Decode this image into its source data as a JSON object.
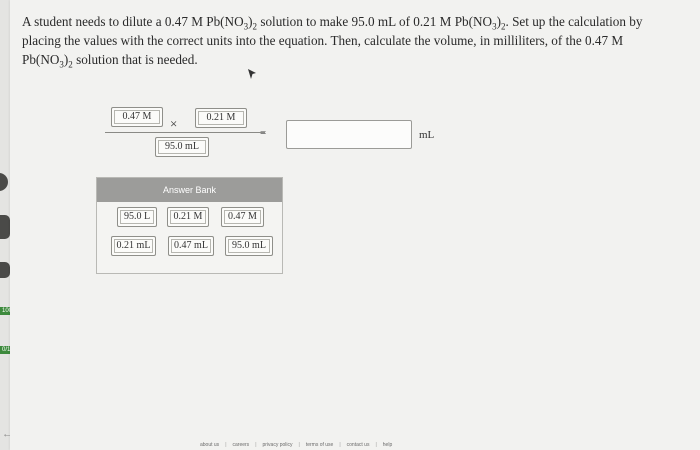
{
  "question": {
    "part1": "A student needs to dilute a 0.47 M Pb(NO",
    "sub1": "3",
    "part2": ")",
    "sub2": "2",
    "part3": " solution to make 95.0 mL of 0.21 M Pb(NO",
    "sub3": "3",
    "part4": ")",
    "sub4": "2",
    "part5": ". Set up the calculation by placing the values with the correct units into the equation. Then, calculate the volume, in milliliters, of the 0.47 M Pb(NO",
    "sub5": "3",
    "part6": ")",
    "sub6": "2",
    "part7": " solution that is needed."
  },
  "equation": {
    "numerator_left": "0.47 M",
    "times_symbol": "×",
    "numerator_right": "0.21 M",
    "denominator": "95.0 mL",
    "equals_symbol": "=",
    "answer_value": "",
    "answer_unit": "mL"
  },
  "answer_bank": {
    "title": "Answer Bank",
    "row1": [
      "95.0 L",
      "0.21 M",
      "0.47 M"
    ],
    "row2": [
      "0.21 mL",
      "0.47 mL",
      "95.0 mL"
    ]
  },
  "side": {
    "score1": "100",
    "score2": "0/100"
  },
  "footer": {
    "links": [
      "about us",
      "careers",
      "privacy policy",
      "terms of use",
      "contact us",
      "help"
    ]
  },
  "colors": {
    "background": "#f2f2f0",
    "bank_header": "#9c9c9a",
    "side_tab": "#4a4a48",
    "score_badge": "#3d8a3d"
  }
}
